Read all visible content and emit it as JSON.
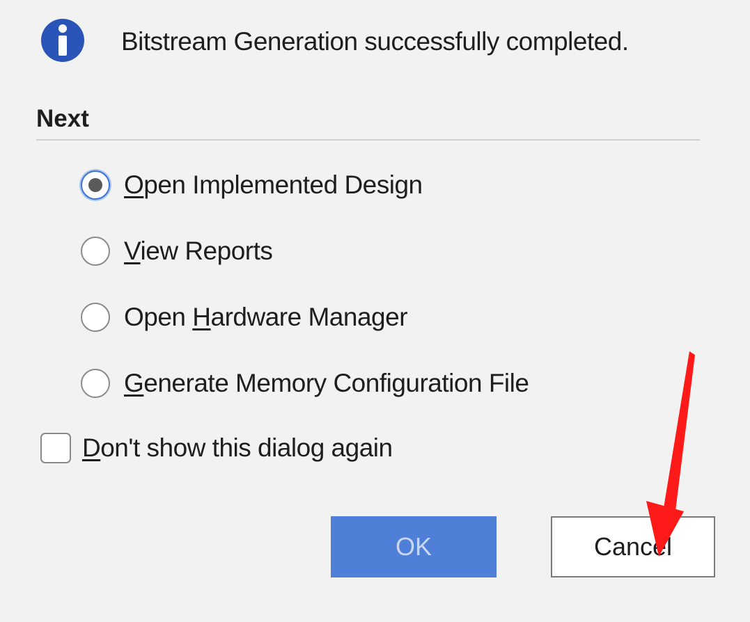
{
  "dialog": {
    "message": "Bitstream Generation successfully completed.",
    "icon": "info-icon",
    "section_title": "Next",
    "options": [
      {
        "pre": "",
        "key": "O",
        "post": "pen Implemented Design",
        "checked": true
      },
      {
        "pre": "",
        "key": "V",
        "post": "iew Reports",
        "checked": false
      },
      {
        "pre": "Open ",
        "key": "H",
        "post": "ardware Manager",
        "checked": false
      },
      {
        "pre": "",
        "key": "G",
        "post": "enerate Memory Configuration File",
        "checked": false
      }
    ],
    "dont_show": {
      "key": "D",
      "post": "on't show this dialog again",
      "checked": false
    },
    "buttons": {
      "ok": "OK",
      "cancel": "Cancel"
    }
  },
  "colors": {
    "background": "#f2f2f2",
    "info_icon": "#2a54b8",
    "ok_button": "#4f7fd6",
    "annotation_arrow": "#ff1a1a"
  }
}
